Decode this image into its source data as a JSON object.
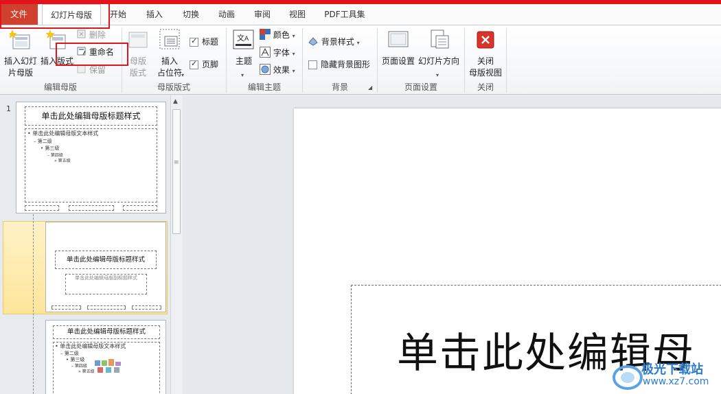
{
  "tabs": {
    "file": "文件",
    "slide_master": "幻灯片母版",
    "start": "开始",
    "insert": "插入",
    "transition": "切换",
    "animation": "动画",
    "review": "审阅",
    "view": "视图",
    "pdf_tools": "PDF工具集"
  },
  "ribbon": {
    "edit_master": {
      "label": "编辑母版",
      "insert_slide_master": "插入幻灯\n片母版",
      "insert_layout": "插入版式",
      "delete": "删除",
      "rename": "重命名",
      "preserve": "保留"
    },
    "master_layout": {
      "label": "母版版式",
      "master_layout_btn": "母版\n版式",
      "insert_placeholder": "插入\n占位符",
      "title_check": "标题",
      "footer_check": "页脚",
      "title_checked": true,
      "footer_checked": true
    },
    "edit_theme": {
      "label": "编辑主题",
      "theme": "主题",
      "colors": "颜色",
      "fonts": "字体",
      "effects": "效果"
    },
    "background": {
      "label": "背景",
      "background_styles": "背景样式",
      "hide_background_graphics": "隐藏背景图形"
    },
    "page_setup": {
      "label": "页面设置",
      "page_setup_btn": "页面设置",
      "slide_orientation": "幻灯片方向"
    },
    "close": {
      "label": "关闭",
      "close_master_view": "关闭\n母版视图"
    }
  },
  "thumbnails": [
    {
      "number": "1",
      "title": "单击此处编辑母版标题样式",
      "body_lines": [
        "• 单击此处编辑母版文本样式",
        "– 第二级",
        "• 第三级",
        "– 第四级",
        "» 第五级"
      ]
    },
    {
      "number": "",
      "title": "单击此处编辑母版标题样式",
      "subtitle": "单击此处编辑母版副标题样式"
    },
    {
      "number": "",
      "title": "单击此处编辑母版标题样式",
      "body_lines": [
        "• 单击此处编辑母版文本样式",
        "– 第二级",
        "• 第三级",
        "– 第四级",
        "» 第五级"
      ]
    }
  ],
  "main_slide": {
    "title": "单击此处编辑母"
  },
  "watermark": {
    "name": "极光下载站",
    "url": "www.xz7.com"
  },
  "colors": {
    "accent_red": "#e3131b",
    "file_tab": "#d0402e",
    "selection": "#fde59b"
  }
}
